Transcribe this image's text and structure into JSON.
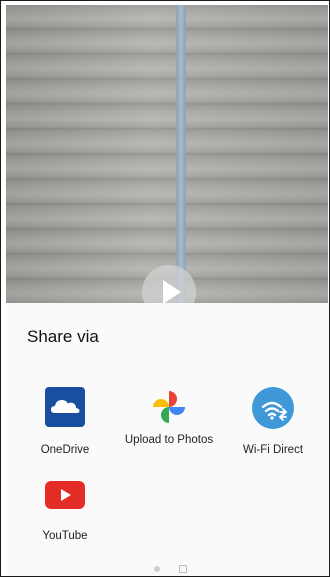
{
  "media": {
    "play_icon": "play-icon"
  },
  "share": {
    "title": "Share via",
    "apps": [
      {
        "label": "OneDrive",
        "icon": "onedrive-icon",
        "color": "#1a4fa0"
      },
      {
        "label": "Upload to Photos",
        "icon": "google-photos-icon",
        "color": "#ffffff"
      },
      {
        "label": "Wi-Fi Direct",
        "icon": "wifi-direct-icon",
        "color": "#3f98d8"
      },
      {
        "label": "YouTube",
        "icon": "youtube-icon",
        "color": "#e52d27"
      }
    ]
  },
  "pager": {
    "indicators": [
      "dot",
      "square"
    ]
  }
}
